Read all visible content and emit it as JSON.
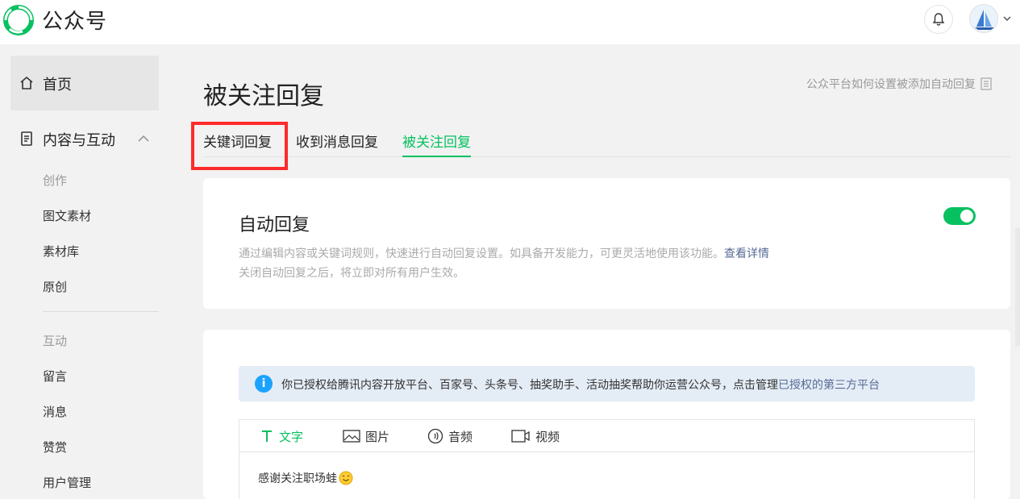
{
  "header": {
    "brand": "公众号",
    "icons": {
      "logo": "wechat-mp-logo",
      "bell": "bell-icon",
      "avatar": "avatar",
      "caret": "chevron-down-icon"
    }
  },
  "sidebar": {
    "home": "首页",
    "content_section": "内容与互动",
    "create_group": "创作",
    "create_items": [
      "图文素材",
      "素材库",
      "原创"
    ],
    "interact_group": "互动",
    "interact_items": [
      "留言",
      "消息",
      "赞赏",
      "用户管理"
    ]
  },
  "main": {
    "title": "被关注回复",
    "help_link": "公众平台如何设置被添加自动回复",
    "tabs": [
      {
        "label": "关键词回复",
        "active": false
      },
      {
        "label": "收到消息回复",
        "active": false
      },
      {
        "label": "被关注回复",
        "active": true
      }
    ],
    "auto_reply": {
      "title": "自动回复",
      "desc1": "通过编辑内容或关键词规则，快速进行自动回复设置。如具备开发能力，可更灵活地使用该功能。",
      "desc1_link": "查看详情",
      "desc2": "关闭自动回复之后，将立即对所有用户生效。",
      "enabled": true
    },
    "notice": {
      "text": "你已授权给腾讯内容开放平台、百家号、头条号、抽奖助手、活动抽奖帮助你运营公众号，点击管理",
      "link": "已授权的第三方平台"
    },
    "editor": {
      "tools": [
        {
          "label": "文字",
          "icon": "text-icon",
          "active": true
        },
        {
          "label": "图片",
          "icon": "image-icon",
          "active": false
        },
        {
          "label": "音频",
          "icon": "audio-icon",
          "active": false
        },
        {
          "label": "视频",
          "icon": "video-icon",
          "active": false
        }
      ],
      "content": "感谢关注职场蛙"
    }
  },
  "colors": {
    "accent": "#07c160",
    "link": "#576b95",
    "highlight": "#ff2a2a",
    "info": "#1aa3ff"
  }
}
